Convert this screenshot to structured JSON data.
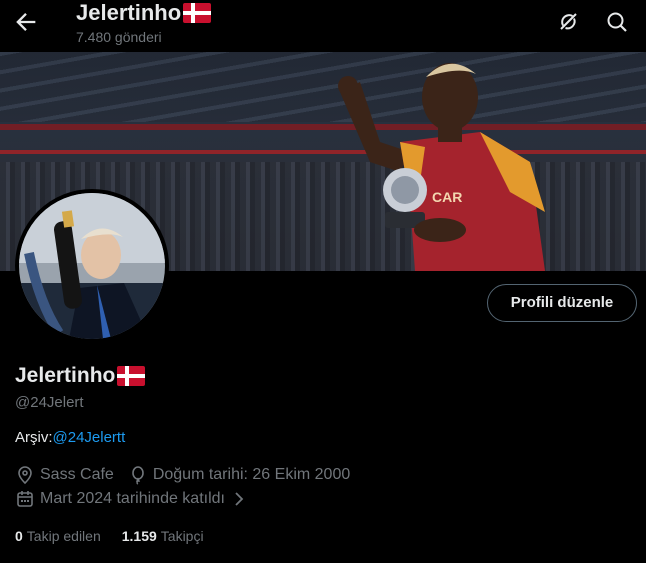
{
  "header": {
    "title": "Jelertinho",
    "posts_count": "7.480 gönderi",
    "back_icon": "arrow-left-icon",
    "grok_icon": "grok-icon",
    "search_icon": "search-icon"
  },
  "profile": {
    "display_name": "Jelertinho",
    "handle": "@24Jelert",
    "bio_prefix": "Arşiv:",
    "bio_link": "@24Jelertt",
    "location": "Sass Cafe",
    "birthday": "Doğum tarihi: 26 Ekim 2000",
    "joined": "Mart 2024 tarihinde katıldı",
    "edit_button": "Profili düzenle",
    "flag": "Denmark"
  },
  "stats": {
    "following_count": "0",
    "following_label": "Takip edilen",
    "followers_count": "1.159",
    "followers_label": "Takipçi"
  },
  "colors": {
    "background": "#000000",
    "text": "#e7e9ea",
    "muted": "#71767b",
    "link": "#1d9bf0",
    "border": "#536471"
  }
}
